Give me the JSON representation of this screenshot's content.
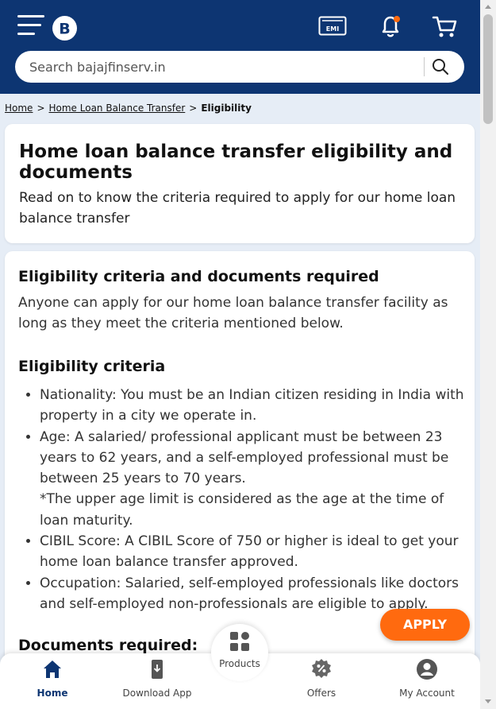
{
  "header": {
    "logo_letter": "B",
    "emi_label": "EMI",
    "search_placeholder": "Search bajajfinserv.in",
    "accent_color": "#0d3572",
    "notification_dot_color": "#ff6a0f"
  },
  "breadcrumb": {
    "items": [
      "Home",
      "Home Loan Balance Transfer"
    ],
    "separator": ">",
    "current": "Eligibility"
  },
  "intro_card": {
    "title": "Home loan balance transfer eligibility and documents",
    "subtitle": "Read on to know the criteria required to apply for our home loan balance transfer"
  },
  "eligibility_card": {
    "heading": "Eligibility criteria and documents required",
    "intro": "Anyone can apply for our home loan balance transfer facility as long as they meet the criteria mentioned below.",
    "criteria_heading": "Eligibility criteria",
    "criteria": [
      "Nationality: You must be an Indian citizen residing in India with property in a city we operate in.",
      "Age: A salaried/ professional applicant must be between 23 years to 62 years, and a self-employed professional must be between 25 years to 70 years.",
      "*The upper age limit is considered as the age at the time of loan maturity.",
      "CIBIL Score: A CIBIL Score of 750 or higher is ideal to get your home loan balance transfer approved.",
      "Occupation: Salaried, self-employed professionals like doctors and self-employed non-professionals are eligible to apply."
    ],
    "documents_heading": "Documents required:"
  },
  "apply_button": {
    "label": "APPLY",
    "color": "#ff6a0f"
  },
  "bottom_nav": {
    "items": [
      {
        "label": "Home",
        "icon": "home-icon"
      },
      {
        "label": "Download App",
        "icon": "phone-download-icon"
      },
      {
        "label": "Products",
        "icon": "grid-icon"
      },
      {
        "label": "Offers",
        "icon": "offer-badge-icon"
      },
      {
        "label": "My Account",
        "icon": "user-icon"
      }
    ]
  }
}
